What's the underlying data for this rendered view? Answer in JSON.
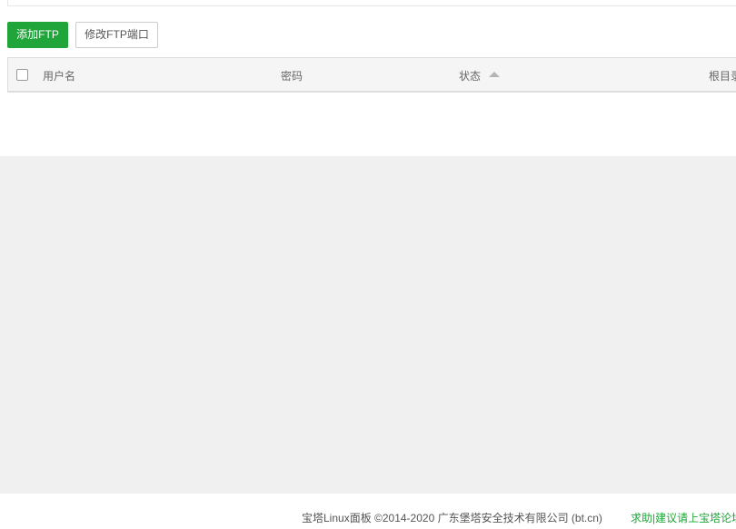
{
  "toolbar": {
    "add_ftp_label": "添加FTP",
    "modify_port_label": "修改FTP端口"
  },
  "table": {
    "columns": {
      "username": "用户名",
      "password": "密码",
      "status": "状态",
      "root_dir": "根目录"
    },
    "sort": {
      "column": "status",
      "direction": "asc"
    },
    "rows": []
  },
  "footer": {
    "copyright": "宝塔Linux面板 ©2014-2020 广东堡塔安全技术有限公司 (bt.cn)",
    "help_link": "求助|建议请上宝塔论坛"
  },
  "colors": {
    "primary": "#20a53a",
    "page_bg": "#f0f0f0"
  }
}
